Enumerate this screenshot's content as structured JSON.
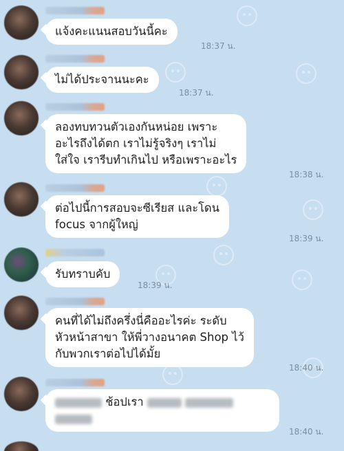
{
  "messages": [
    {
      "text": [
        "แจ้งคะแนนสอบวันนี้คะ"
      ],
      "time": "18:37 น."
    },
    {
      "text": [
        "ไม่ได้ประจานนะคะ"
      ],
      "time": "18:37 น."
    },
    {
      "text": [
        "ลองทบทวนตัวเองกันหน่อย เพราะ",
        "อะไรถึงได้ตก เราไม่รู้จริงๆ เราไม่",
        "ใส่ใจ เรารีบทำเกินไป หรือเพราะอะไร"
      ],
      "time": "18:38 น."
    },
    {
      "text": [
        "ต่อไปนี้การสอบจะซีเรียส และโดน",
        "focus จากผู้ใหญ่"
      ],
      "time": "18:39 น."
    },
    {
      "text": [
        "รับทราบคับ"
      ],
      "time": "18:39 น."
    },
    {
      "text": [
        "คนที่ได้ไม่ถึงครึ่งนี่คืออะไรค่ะ ระดับ",
        "หัวหน้าสาขา ให้พี่วางอนาคต Shop ไว้",
        "กับพวกเราต่อไปได้มั้ย"
      ],
      "time": "18:40 น."
    },
    {
      "text": [
        "ช้อปเรา"
      ],
      "time": "18:40 น."
    }
  ]
}
